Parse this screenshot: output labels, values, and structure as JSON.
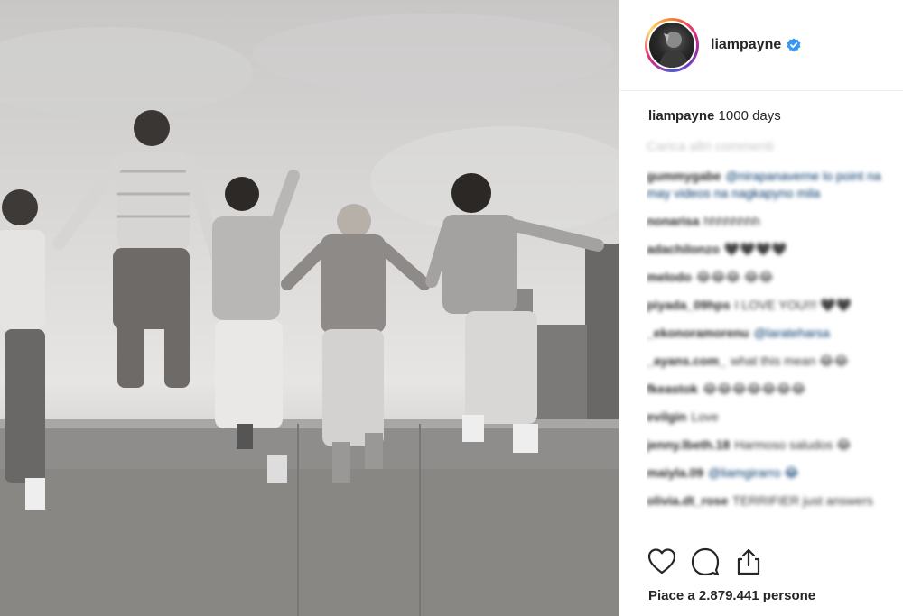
{
  "post": {
    "username": "liampayne",
    "caption_user": "liampayne",
    "caption_text": "1000 days",
    "load_more": "Carica altri commenti",
    "likes_text": "Piace a 2.879.441 persone"
  },
  "comments": [
    {
      "user": "gummygabe",
      "text": "@nirapanaverne lo point na may videos na nagkapyno mila"
    },
    {
      "user": "nonarisa",
      "text": "hhhhhhhh"
    },
    {
      "user": "adachilonzo",
      "text": "🖤🖤🖤🖤"
    },
    {
      "user": "melodo",
      "text": "😂😂😂 😂😂"
    },
    {
      "user": "piyada_09hps",
      "text": "I LOVE YOU!!! 🖤🖤"
    },
    {
      "user": "_ekonoramorenu",
      "text": "@larateharsa"
    },
    {
      "user": "_ayans.com_",
      "text": "what this mean 😂😂"
    },
    {
      "user": "fkeastok",
      "text": "😂😂😂😂😂😂😂"
    },
    {
      "user": "evilgin",
      "text": "Love"
    },
    {
      "user": "jenny.lbeth.18",
      "text": "Harmoso saludos 😂"
    },
    {
      "user": "maiyla.09",
      "text": "@liamgirarro 😂"
    },
    {
      "user": "olivia.dt_rose",
      "text": "TERRIFIER just answers"
    }
  ],
  "icons": {
    "like": "heart-icon",
    "comment": "comment-bubble-icon",
    "share": "share-icon",
    "verified": "verified-badge-icon"
  },
  "colors": {
    "verified": "#3897f0",
    "mention": "#003569",
    "divider": "#efefef"
  }
}
